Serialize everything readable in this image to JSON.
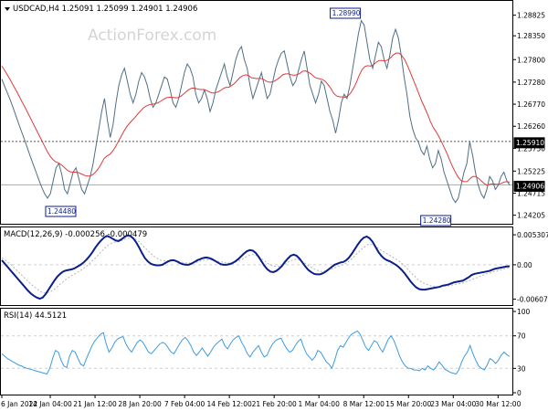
{
  "header": {
    "symbol_line": "USDCAD,H4  1.25091 1.25099 1.24901 1.24906",
    "watermark": "ActionForex.com"
  },
  "colors": {
    "price_line": "#4f6f85",
    "ma_line": "#e03a3a",
    "macd_line": "#0b1f8c",
    "signal_line": "#b5b5b5",
    "rsi_line": "#3d9be0",
    "grid": "#cfcfcf",
    "axis_text": "#000000"
  },
  "chart_data": [
    {
      "type": "line",
      "panel": "price",
      "title": "USDCAD,H4",
      "ylim": [
        1.2405,
        1.2905
      ],
      "y_ticks": [
        "1.28825",
        "1.28350",
        "1.27800",
        "1.27280",
        "1.26770",
        "1.26260",
        "1.25750",
        "1.25225",
        "1.24715",
        "1.24205"
      ],
      "y_tick_values": [
        1.28825,
        1.2835,
        1.278,
        1.2728,
        1.2677,
        1.2626,
        1.2575,
        1.25225,
        1.24715,
        1.24205
      ],
      "x_ticks": [
        "6 Jan 2022",
        "14 Jan 04:00",
        "21 Jan 12:00",
        "28 Jan 20:00",
        "7 Feb 04:00",
        "14 Feb 12:00",
        "21 Feb 20:00",
        "1 Mar 04:00",
        "8 Mar 12:00",
        "15 Mar 20:00",
        "23 Mar 04:00",
        "30 Mar 12:00"
      ],
      "close_series": [
        1.2735,
        1.2718,
        1.2702,
        1.2686,
        1.2668,
        1.2649,
        1.263,
        1.2612,
        1.2594,
        1.2575,
        1.2556,
        1.2538,
        1.252,
        1.2502,
        1.2485,
        1.247,
        1.246,
        1.247,
        1.25,
        1.253,
        1.254,
        1.2515,
        1.248,
        1.247,
        1.2495,
        1.252,
        1.253,
        1.2505,
        1.248,
        1.247,
        1.249,
        1.251,
        1.254,
        1.258,
        1.262,
        1.266,
        1.269,
        1.264,
        1.26,
        1.263,
        1.268,
        1.272,
        1.2745,
        1.276,
        1.273,
        1.27,
        1.268,
        1.27,
        1.273,
        1.275,
        1.274,
        1.272,
        1.269,
        1.267,
        1.268,
        1.27,
        1.272,
        1.274,
        1.2735,
        1.271,
        1.268,
        1.267,
        1.269,
        1.272,
        1.275,
        1.277,
        1.276,
        1.274,
        1.27,
        1.268,
        1.269,
        1.271,
        1.269,
        1.266,
        1.268,
        1.271,
        1.273,
        1.275,
        1.277,
        1.274,
        1.272,
        1.275,
        1.278,
        1.28,
        1.281,
        1.278,
        1.276,
        1.272,
        1.269,
        1.271,
        1.273,
        1.275,
        1.272,
        1.269,
        1.27,
        1.273,
        1.276,
        1.278,
        1.2795,
        1.28,
        1.277,
        1.274,
        1.272,
        1.273,
        1.2755,
        1.278,
        1.28,
        1.276,
        1.272,
        1.27,
        1.268,
        1.27,
        1.273,
        1.272,
        1.269,
        1.266,
        1.264,
        1.261,
        1.264,
        1.268,
        1.27,
        1.269,
        1.272,
        1.276,
        1.28,
        1.284,
        1.287,
        1.286,
        1.282,
        1.278,
        1.276,
        1.279,
        1.282,
        1.281,
        1.278,
        1.276,
        1.279,
        1.283,
        1.285,
        1.283,
        1.279,
        1.274,
        1.27,
        1.265,
        1.262,
        1.26,
        1.259,
        1.257,
        1.256,
        1.258,
        1.255,
        1.253,
        1.254,
        1.257,
        1.255,
        1.252,
        1.25,
        1.248,
        1.246,
        1.245,
        1.246,
        1.249,
        1.252,
        1.254,
        1.259,
        1.256,
        1.252,
        1.249,
        1.247,
        1.246,
        1.248,
        1.251,
        1.25,
        1.248,
        1.249,
        1.251,
        1.252,
        1.25,
        1.24906
      ],
      "ma_series": [
        1.2765,
        1.2755,
        1.2744,
        1.2733,
        1.2721,
        1.2709,
        1.2697,
        1.2684,
        1.2672,
        1.2659,
        1.2646,
        1.2633,
        1.262,
        1.2607,
        1.2594,
        1.2581,
        1.2568,
        1.2557,
        1.2549,
        1.2544,
        1.2541,
        1.2537,
        1.2531,
        1.2525,
        1.2521,
        1.252,
        1.252,
        1.2519,
        1.2516,
        1.2513,
        1.2511,
        1.2511,
        1.2514,
        1.252,
        1.2528,
        1.2539,
        1.2551,
        1.2557,
        1.2561,
        1.2568,
        1.2578,
        1.259,
        1.2602,
        1.2614,
        1.2625,
        1.2633,
        1.264,
        1.2647,
        1.2655,
        1.2662,
        1.2669,
        1.2673,
        1.2676,
        1.2677,
        1.2678,
        1.268,
        1.2684,
        1.2688,
        1.2692,
        1.2693,
        1.2693,
        1.2692,
        1.2692,
        1.2695,
        1.27,
        1.2706,
        1.2711,
        1.2714,
        1.2714,
        1.2712,
        1.2711,
        1.2711,
        1.2709,
        1.2706,
        1.2703,
        1.2703,
        1.2705,
        1.2708,
        1.2713,
        1.2716,
        1.2716,
        1.272,
        1.2725,
        1.2732,
        1.2739,
        1.2743,
        1.2745,
        1.2743,
        1.2738,
        1.2737,
        1.2736,
        1.2737,
        1.2735,
        1.2731,
        1.2728,
        1.2728,
        1.273,
        1.2734,
        1.2739,
        1.2745,
        1.2747,
        1.2747,
        1.2745,
        1.2744,
        1.2745,
        1.2748,
        1.2753,
        1.2754,
        1.2751,
        1.2747,
        1.2741,
        1.2737,
        1.2736,
        1.2734,
        1.273,
        1.2722,
        1.2713,
        1.2702,
        1.2696,
        1.2694,
        1.2694,
        1.2693,
        1.2696,
        1.2703,
        1.2714,
        1.2728,
        1.2744,
        1.2757,
        1.2764,
        1.2766,
        1.2765,
        1.2768,
        1.2774,
        1.2778,
        1.2778,
        1.2777,
        1.2779,
        1.2784,
        1.2791,
        1.2795,
        1.2795,
        1.2789,
        1.278,
        1.2766,
        1.275,
        1.2734,
        1.2718,
        1.2701,
        1.2684,
        1.267,
        1.2655,
        1.2638,
        1.2624,
        1.2614,
        1.2603,
        1.259,
        1.2576,
        1.2562,
        1.2546,
        1.2531,
        1.2518,
        1.2507,
        1.25,
        1.2498,
        1.2498,
        1.2505,
        1.251,
        1.251,
        1.2506,
        1.25,
        1.2494,
        1.249,
        1.2492,
        1.2493,
        1.2492,
        1.2492,
        1.2494,
        1.2497,
        1.2498,
        1.2497
      ],
      "annotations": {
        "high_label": "1.28990",
        "low_left_label": "1.24480",
        "low_right_label": "1.24280",
        "hline_level_label": "1.25910",
        "current_price_label": "1.24906"
      }
    },
    {
      "type": "line",
      "panel": "macd",
      "title": "MACD(12,26,9) -0.000256 -0.000479",
      "ylim": [
        -0.0068,
        0.0058
      ],
      "y_ticks": [
        "0.005307",
        "0.00",
        "-0.006074"
      ],
      "y_tick_values": [
        0.005307,
        0.0,
        -0.006074
      ],
      "macd_series": [
        0.0008,
        0.0002,
        -0.0004,
        -0.001,
        -0.0016,
        -0.0022,
        -0.0028,
        -0.0034,
        -0.004,
        -0.0046,
        -0.0051,
        -0.0055,
        -0.0058,
        -0.006,
        -0.0058,
        -0.0052,
        -0.0044,
        -0.0036,
        -0.0028,
        -0.0021,
        -0.0016,
        -0.0012,
        -0.001,
        -0.0009,
        -0.0008,
        -0.0006,
        -0.0003,
        0.0,
        0.0004,
        0.0009,
        0.0015,
        0.0022,
        0.003,
        0.0037,
        0.0043,
        0.0048,
        0.0051,
        0.0049,
        0.0046,
        0.0043,
        0.0042,
        0.0045,
        0.0049,
        0.0052,
        0.0051,
        0.0047,
        0.004,
        0.0031,
        0.0021,
        0.0012,
        0.0006,
        0.0002,
        0.0,
        -0.0001,
        -0.0001,
        0.0,
        0.0003,
        0.0006,
        0.0008,
        0.0008,
        0.0006,
        0.0003,
        0.0001,
        0.0,
        0.0,
        0.0002,
        0.0005,
        0.0008,
        0.001,
        0.0012,
        0.0013,
        0.0012,
        0.001,
        0.0007,
        0.0004,
        0.0001,
        0.0,
        0.0,
        0.0001,
        0.0003,
        0.0006,
        0.001,
        0.0015,
        0.002,
        0.0024,
        0.0026,
        0.0025,
        0.0021,
        0.0014,
        0.0006,
        -0.0002,
        -0.0008,
        -0.0012,
        -0.0013,
        -0.0011,
        -0.0007,
        -0.0002,
        0.0005,
        0.0011,
        0.0016,
        0.0018,
        0.0016,
        0.0011,
        0.0004,
        -0.0003,
        -0.0009,
        -0.0013,
        -0.0016,
        -0.0017,
        -0.0017,
        -0.0015,
        -0.0012,
        -0.0008,
        -0.0004,
        0.0,
        0.0002,
        0.0004,
        0.0005,
        0.0008,
        0.0013,
        0.002,
        0.0028,
        0.0036,
        0.0043,
        0.0048,
        0.005,
        0.0047,
        0.0041,
        0.0032,
        0.0023,
        0.0016,
        0.0011,
        0.0008,
        0.0006,
        0.0003,
        0.0,
        -0.0004,
        -0.0009,
        -0.0015,
        -0.0022,
        -0.0029,
        -0.0035,
        -0.004,
        -0.0043,
        -0.0044,
        -0.0044,
        -0.0043,
        -0.0042,
        -0.0041,
        -0.004,
        -0.0039,
        -0.0037,
        -0.0036,
        -0.0035,
        -0.0033,
        -0.0031,
        -0.003,
        -0.0029,
        -0.0028,
        -0.0025,
        -0.0022,
        -0.0018,
        -0.0016,
        -0.0015,
        -0.0014,
        -0.0013,
        -0.0012,
        -0.0011,
        -0.0009,
        -0.0007,
        -0.0006,
        -0.0005,
        -0.0004,
        -0.0003,
        -0.000256
      ],
      "signal_series": [
        0.0012,
        0.0009,
        0.0005,
        0.0001,
        -0.0004,
        -0.0009,
        -0.0014,
        -0.0019,
        -0.0024,
        -0.0029,
        -0.0034,
        -0.0038,
        -0.0042,
        -0.0046,
        -0.0049,
        -0.005,
        -0.0049,
        -0.0047,
        -0.0044,
        -0.004,
        -0.0035,
        -0.0031,
        -0.0027,
        -0.0023,
        -0.002,
        -0.0017,
        -0.0014,
        -0.0011,
        -0.0008,
        -0.0004,
        0.0,
        0.0005,
        0.001,
        0.0015,
        0.0021,
        0.0026,
        0.0031,
        0.0035,
        0.0038,
        0.004,
        0.0041,
        0.0042,
        0.0044,
        0.0046,
        0.0047,
        0.0047,
        0.0046,
        0.0043,
        0.0039,
        0.0033,
        0.0028,
        0.0023,
        0.0018,
        0.0014,
        0.0011,
        0.0008,
        0.0007,
        0.0007,
        0.0007,
        0.0007,
        0.0007,
        0.0006,
        0.0005,
        0.0004,
        0.0003,
        0.0003,
        0.0003,
        0.0004,
        0.0005,
        0.0007,
        0.0008,
        0.0009,
        0.0009,
        0.0009,
        0.0008,
        0.0006,
        0.0005,
        0.0004,
        0.0003,
        0.0003,
        0.0003,
        0.0005,
        0.0007,
        0.0009,
        0.0012,
        0.0015,
        0.0017,
        0.0018,
        0.0017,
        0.0015,
        0.0011,
        0.0007,
        0.0003,
        0.0,
        -0.0002,
        -0.0003,
        -0.0003,
        -0.0001,
        0.0001,
        0.0004,
        0.0007,
        0.0009,
        0.001,
        0.0009,
        0.0006,
        0.0003,
        -0.0001,
        -0.0004,
        -0.0007,
        -0.0009,
        -0.0011,
        -0.0012,
        -0.0011,
        -0.001,
        -0.0008,
        -0.0006,
        -0.0004,
        -0.0002,
        0.0,
        0.0002,
        0.0005,
        0.0009,
        0.0014,
        0.0019,
        0.0024,
        0.0029,
        0.0033,
        0.0036,
        0.0036,
        0.0034,
        0.0031,
        0.0027,
        0.0024,
        0.0021,
        0.0018,
        0.0015,
        0.0012,
        0.0009,
        0.0005,
        0.0001,
        -0.0004,
        -0.001,
        -0.0015,
        -0.002,
        -0.0025,
        -0.0029,
        -0.0032,
        -0.0034,
        -0.0036,
        -0.0038,
        -0.0038,
        -0.0039,
        -0.0039,
        -0.0038,
        -0.0038,
        -0.0037,
        -0.0036,
        -0.0035,
        -0.0034,
        -0.0033,
        -0.0032,
        -0.003,
        -0.0028,
        -0.0026,
        -0.0024,
        -0.0022,
        -0.002,
        -0.0018,
        -0.0016,
        -0.0015,
        -0.0013,
        -0.0012,
        -0.001,
        -0.0009,
        -0.0007,
        -0.0006,
        -0.000479
      ]
    },
    {
      "type": "line",
      "panel": "rsi",
      "title": "RSI(14) 44.5121",
      "ylim": [
        0,
        100
      ],
      "y_ticks": [
        "100",
        "70",
        "30",
        "0"
      ],
      "y_tick_values": [
        100,
        70,
        30,
        0
      ],
      "rsi_series": [
        48,
        45,
        42,
        40,
        38,
        36,
        34,
        33,
        31,
        30,
        29,
        28,
        27,
        26,
        25,
        24,
        23,
        30,
        42,
        52,
        50,
        40,
        33,
        31,
        45,
        52,
        50,
        42,
        35,
        33,
        42,
        50,
        58,
        64,
        68,
        72,
        74,
        60,
        50,
        55,
        62,
        66,
        68,
        69,
        60,
        54,
        50,
        56,
        62,
        65,
        62,
        56,
        50,
        48,
        52,
        56,
        60,
        62,
        60,
        55,
        50,
        48,
        54,
        60,
        65,
        68,
        64,
        58,
        50,
        46,
        50,
        55,
        50,
        45,
        50,
        56,
        60,
        63,
        66,
        58,
        54,
        60,
        65,
        68,
        70,
        62,
        56,
        48,
        44,
        50,
        54,
        58,
        50,
        44,
        46,
        54,
        60,
        64,
        66,
        67,
        60,
        54,
        50,
        52,
        58,
        63,
        66,
        56,
        48,
        44,
        40,
        44,
        52,
        50,
        44,
        38,
        35,
        30,
        40,
        52,
        58,
        56,
        62,
        68,
        72,
        74,
        76,
        72,
        64,
        56,
        52,
        58,
        64,
        62,
        55,
        50,
        58,
        66,
        70,
        64,
        55,
        45,
        38,
        33,
        30,
        30,
        28,
        28,
        27,
        30,
        28,
        33,
        30,
        28,
        32,
        38,
        34,
        29,
        27,
        25,
        24,
        23,
        28,
        38,
        45,
        50,
        58,
        48,
        40,
        33,
        30,
        28,
        34,
        42,
        40,
        36,
        40,
        46,
        50,
        47,
        44.5121
      ]
    }
  ]
}
